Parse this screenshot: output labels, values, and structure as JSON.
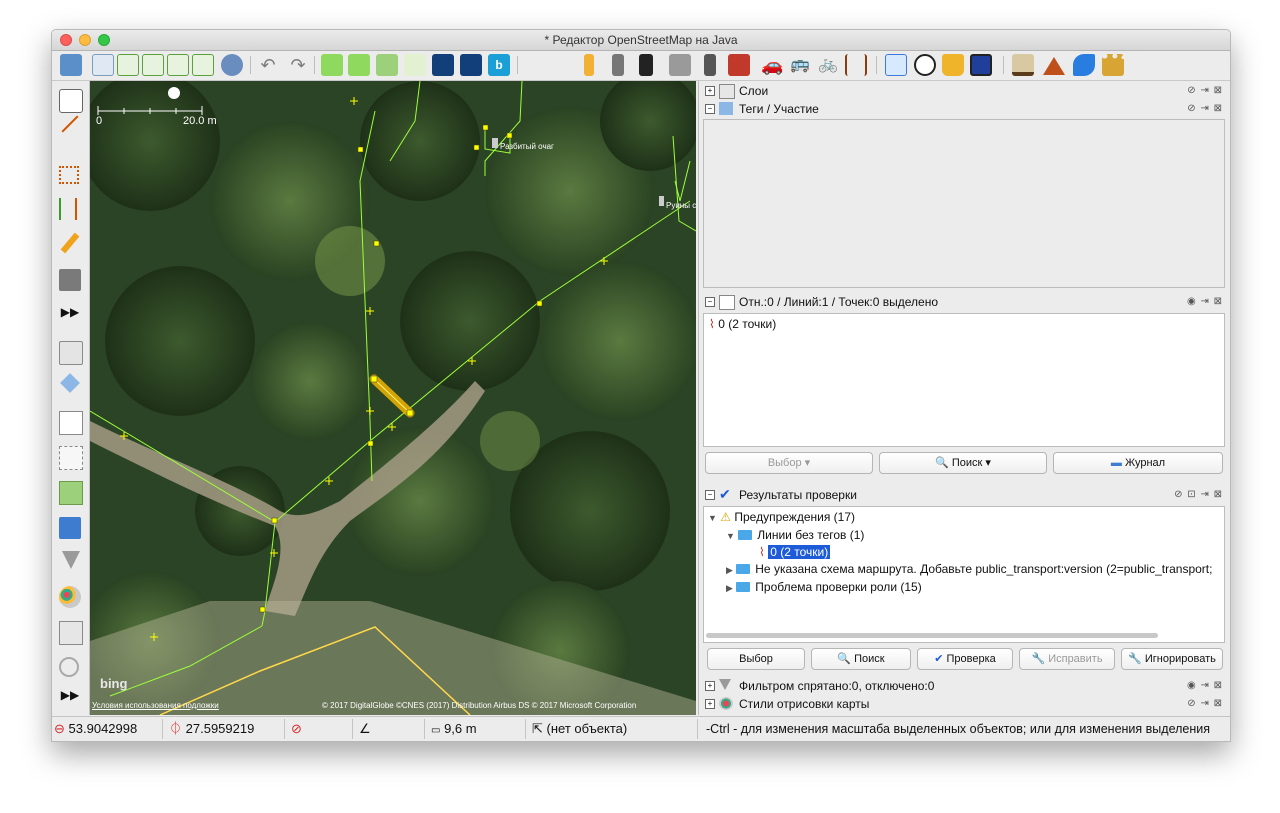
{
  "window": {
    "title": "* Редактор OpenStreetMap на Java"
  },
  "toolbar": {
    "buttons": [
      "open-file",
      "open-location",
      "download",
      "download-along",
      "upload",
      "save",
      "preferences",
      "undo",
      "redo",
      "zoom-best-fit",
      "zoom-to-data",
      "wms",
      "search",
      "combine-way",
      "split-way",
      "bing",
      "road",
      "motorway",
      "rail",
      "parking",
      "building",
      "car",
      "bus",
      "bicycle",
      "railway",
      "hotel",
      "football",
      "shop",
      "info",
      "industrial",
      "peak",
      "waterway",
      "castle"
    ]
  },
  "map": {
    "scale_start": "0",
    "scale_end": "20.0 m",
    "labels": [
      "Разбитый очаг",
      "Руины с"
    ],
    "attribution_link": "Условия использования подложки",
    "attribution": "© 2017 DigitalGlobe ©CNES (2017) Distribution Airbus DS © 2017 Microsoft Corporation",
    "bing_logo": "bing"
  },
  "panels": {
    "layers": {
      "title": "Слои"
    },
    "tags": {
      "title": "Теги / Участие"
    },
    "selection": {
      "title": "Отн.:0 / Линий:1 / Точек:0 выделено",
      "item": "0 (2 точки)",
      "btn_select": "Выбор",
      "btn_search": "Поиск",
      "btn_history": "Журнал"
    },
    "validator": {
      "title": "Результаты проверки",
      "warnings": "Предупреждения (17)",
      "untagged": "Линии без тегов (1)",
      "untagged_item": "0 (2 точки)",
      "no_scheme": "Не указана схема маршрута. Добавьте public_transport:version (2=public_transport;",
      "role_problem": "Проблема проверки роли (15)",
      "btn_select": "Выбор",
      "btn_search": "Поиск",
      "btn_validate": "Проверка",
      "btn_fix": "Исправить",
      "btn_ignore": "Игнорировать"
    },
    "filter": {
      "title": "Фильтром спрятано:0, отключено:0"
    },
    "mappaint": {
      "title": "Стили отрисовки карты"
    }
  },
  "status": {
    "lat": "53.9042998",
    "lon": "27.5959219",
    "distance": "9,6 m",
    "object": "(нет объекта)",
    "help": "-Ctrl - для изменения масштаба выделенных объектов; или для изменения выделения"
  },
  "colors": {
    "selected": "#1e5bd8",
    "highlight_way": "#f0b400",
    "osm_line": "#9cff3a"
  }
}
